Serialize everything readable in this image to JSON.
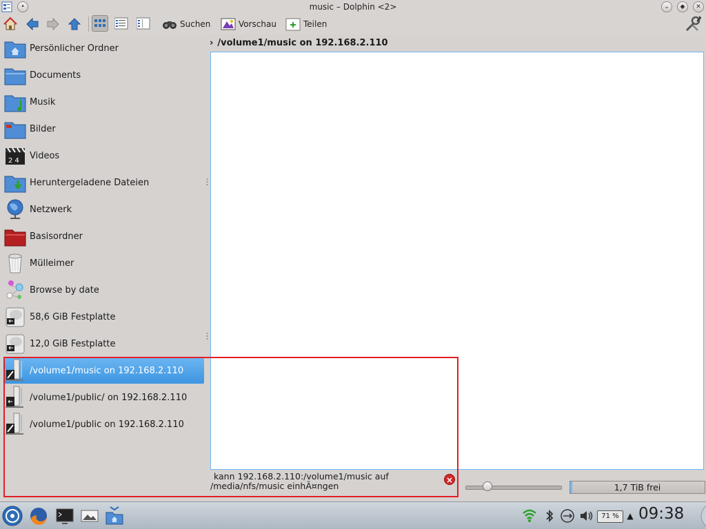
{
  "window": {
    "title": "music – Dolphin <2>"
  },
  "toolbar": {
    "search_label": "Suchen",
    "preview_label": "Vorschau",
    "split_label": "Teilen"
  },
  "places": [
    {
      "label": "Persönlicher Ordner",
      "icon": "home-folder-icon"
    },
    {
      "label": "Documents",
      "icon": "folder-icon"
    },
    {
      "label": "Musik",
      "icon": "music-folder-icon"
    },
    {
      "label": "Bilder",
      "icon": "pictures-folder-icon"
    },
    {
      "label": "Videos",
      "icon": "video-clapper-icon"
    },
    {
      "label": "Heruntergeladene Dateien",
      "icon": "downloads-folder-icon"
    },
    {
      "label": "Netzwerk",
      "icon": "network-globe-icon"
    },
    {
      "label": "Basisordner",
      "icon": "root-folder-icon"
    },
    {
      "label": "Mülleimer",
      "icon": "trash-icon"
    },
    {
      "label": "Browse by date",
      "icon": "timeline-icon"
    },
    {
      "label": "58,6 GiB Festplatte",
      "icon": "harddisk-icon"
    },
    {
      "label": "12,0 GiB Festplatte",
      "icon": "harddisk-icon"
    },
    {
      "label": "/volume1/music on 192.168.2.110",
      "icon": "nfs-share-icon",
      "selected": true
    },
    {
      "label": "/volume1/public/ on 192.168.2.110",
      "icon": "nfs-share-icon"
    },
    {
      "label": "/volume1/public on 192.168.2.110",
      "icon": "nfs-share-icon"
    }
  ],
  "location": {
    "path": "/volume1/music on 192.168.2.110"
  },
  "status": {
    "message_line1": "kann 192.168.2.110:/volume1/music auf",
    "message_line2": "/media/nfs/music einhÃ¤ngen",
    "free_space": "1,7 TiB frei",
    "zoom_level": 0.2
  },
  "taskbar": {
    "battery": "71 %",
    "clock": "09:38"
  },
  "colors": {
    "selection": "#3d95e0",
    "highlight_box": "#e31e24",
    "error": "#d42828"
  }
}
